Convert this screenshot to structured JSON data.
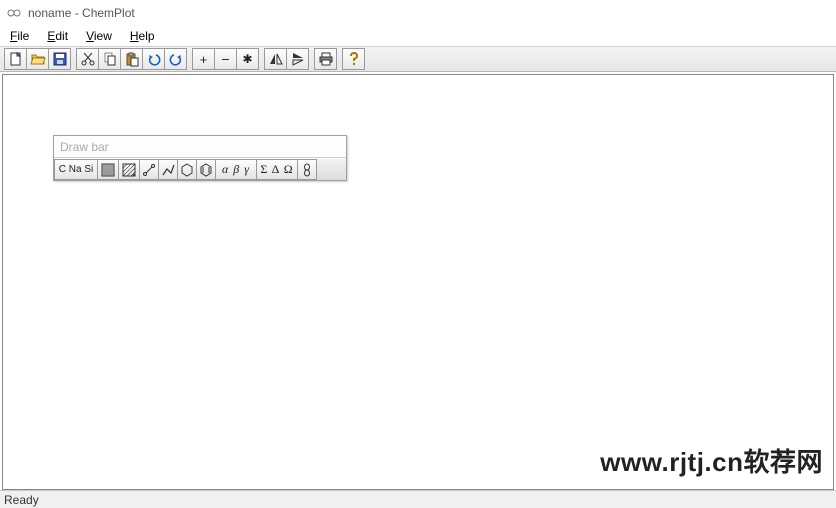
{
  "title": "noname - ChemPlot",
  "menu": {
    "file": "File",
    "edit": "Edit",
    "view": "View",
    "help": "Help"
  },
  "toolbar": {
    "new": "new-icon",
    "open": "open-icon",
    "save": "save-icon",
    "cut": "cut-icon",
    "copy": "copy-icon",
    "paste": "paste-icon",
    "undo": "undo-icon",
    "redo": "redo-icon",
    "plus": "+",
    "minus": "−",
    "star": "✱",
    "flip_h": "flip-horizontal-icon",
    "flip_v": "flip-vertical-icon",
    "print": "print-icon",
    "help": "help-icon"
  },
  "drawbar": {
    "title": "Draw bar",
    "elements_label": "C Na Si",
    "alpha_beta_gamma": "α β γ",
    "sigma_delta_omega": "Σ Δ Ω"
  },
  "watermark": "www.rjtj.cn软荐网",
  "status": "Ready"
}
